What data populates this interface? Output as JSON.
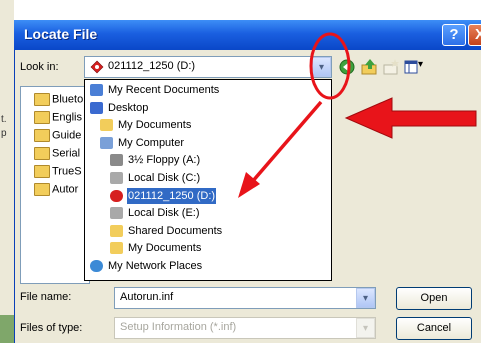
{
  "dialog": {
    "title": "Locate File",
    "help_label": "?",
    "close_label": "X"
  },
  "lookin": {
    "label": "Look in:",
    "value": "021112_1250 (D:)",
    "drop_glyph": "▾"
  },
  "toolbar": {
    "icons": [
      "back-icon",
      "up-folder-icon",
      "new-folder-icon",
      "views-menu-icon"
    ],
    "views_arrow": "▾"
  },
  "side_stubs": [
    "t.",
    "p"
  ],
  "files": [
    "Blueto",
    "Englis",
    "Guide",
    "Serial",
    "TrueS",
    "Autor"
  ],
  "dropdown_items": [
    {
      "label": "My Recent Documents",
      "icon": "recent-documents-icon",
      "indent": 0
    },
    {
      "label": "Desktop",
      "icon": "desktop-icon",
      "indent": 0
    },
    {
      "label": "My Documents",
      "icon": "my-documents-icon",
      "indent": 1
    },
    {
      "label": "My Computer",
      "icon": "my-computer-icon",
      "indent": 1
    },
    {
      "label": "3½ Floppy (A:)",
      "icon": "floppy-icon",
      "indent": 2
    },
    {
      "label": "Local Disk (C:)",
      "icon": "hard-disk-icon",
      "indent": 2
    },
    {
      "label": "021112_1250 (D:)",
      "icon": "cd-drive-icon",
      "indent": 2,
      "selected": true
    },
    {
      "label": "Local Disk (E:)",
      "icon": "hard-disk-icon",
      "indent": 2
    },
    {
      "label": "Shared Documents",
      "icon": "shared-folder-icon",
      "indent": 2
    },
    {
      "label": "My Documents",
      "icon": "folder-icon",
      "indent": 2
    },
    {
      "label": "My Network Places",
      "icon": "network-places-icon",
      "indent": 0
    }
  ],
  "file_name": {
    "label": "File name:",
    "value": "Autorun.inf",
    "drop_glyph": "▾"
  },
  "file_type": {
    "label": "Files of type:",
    "value": "Setup Information (*.inf)",
    "drop_glyph": "▾"
  },
  "buttons": {
    "open": "Open",
    "cancel": "Cancel"
  },
  "annotation_colors": {
    "red": "#e8141a",
    "selection": "#316ac5",
    "titlebar": "#0a47c8"
  }
}
